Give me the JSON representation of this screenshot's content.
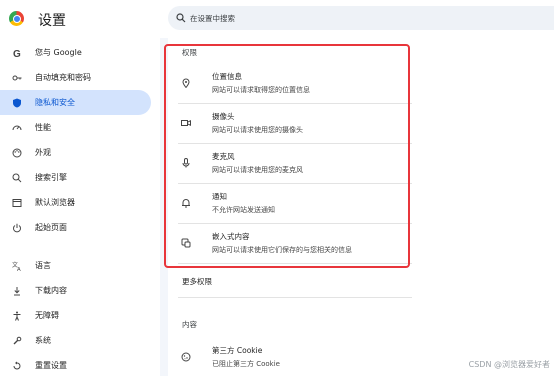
{
  "header": {
    "title": "设置",
    "search_placeholder": "在设置中搜索"
  },
  "sidebar": {
    "items": [
      {
        "label": "您与 Google",
        "icon": "google-g-icon"
      },
      {
        "label": "自动填充和密码",
        "icon": "key-icon"
      },
      {
        "label": "隐私和安全",
        "icon": "shield-icon",
        "active": true
      },
      {
        "label": "性能",
        "icon": "gauge-icon"
      },
      {
        "label": "外观",
        "icon": "palette-icon"
      },
      {
        "label": "搜索引擎",
        "icon": "search-icon"
      },
      {
        "label": "默认浏览器",
        "icon": "browser-icon"
      },
      {
        "label": "起始页面",
        "icon": "power-icon"
      },
      {
        "label": "语言",
        "icon": "translate-icon"
      },
      {
        "label": "下载内容",
        "icon": "download-icon"
      },
      {
        "label": "无障碍",
        "icon": "accessibility-icon"
      },
      {
        "label": "系统",
        "icon": "wrench-icon"
      },
      {
        "label": "重置设置",
        "icon": "reset-icon"
      }
    ]
  },
  "main": {
    "permissions_header": "权限",
    "permissions": [
      {
        "title": "位置信息",
        "sub": "网站可以请求取得您的位置信息",
        "icon": "location-pin-icon"
      },
      {
        "title": "摄像头",
        "sub": "网站可以请求使用您的摄像头",
        "icon": "camera-icon"
      },
      {
        "title": "麦克风",
        "sub": "网站可以请求使用您的麦克风",
        "icon": "microphone-icon"
      },
      {
        "title": "通知",
        "sub": "不允许网站发送通知",
        "icon": "bell-icon"
      },
      {
        "title": "嵌入式内容",
        "sub": "网站可以请求使用它们保存的与您相关的信息",
        "icon": "embedded-content-icon"
      }
    ],
    "more_permissions": "更多权限",
    "content_header": "内容",
    "third_party_cookie": {
      "title": "第三方 Cookie",
      "sub": "已阻止第三方 Cookie",
      "icon": "cookie-icon"
    }
  },
  "watermark": "CSDN @浏览器爱好者",
  "colors": {
    "accent": "#0b57d0",
    "active_bg": "#d3e3fd",
    "highlight": "#e8353b"
  }
}
